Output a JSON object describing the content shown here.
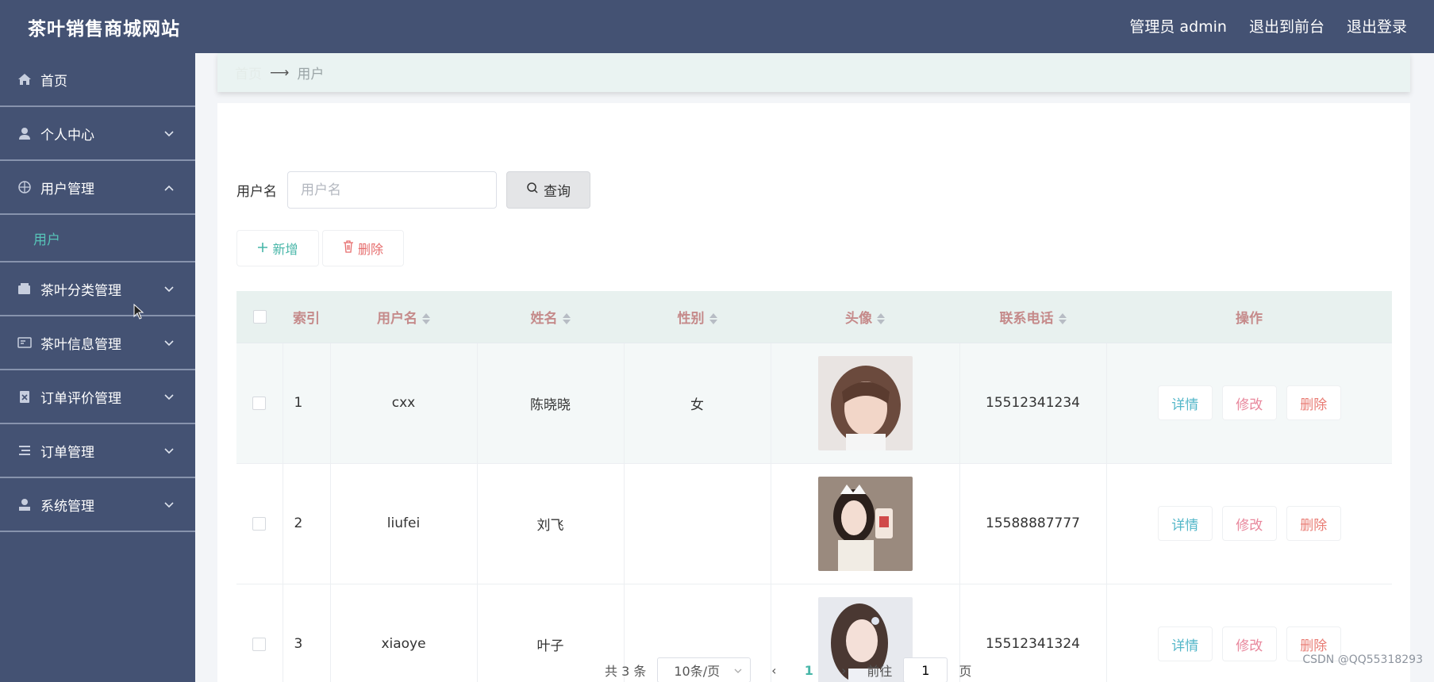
{
  "app": {
    "title": "茶叶销售商城网站",
    "user_label": "管理员 admin",
    "back_to_front": "退出到前台",
    "logout": "退出登录"
  },
  "sidebar": {
    "items": [
      {
        "label": "首页",
        "icon": "home-icon"
      },
      {
        "label": "个人中心",
        "icon": "person-icon"
      },
      {
        "label": "用户管理",
        "icon": "target-icon"
      },
      {
        "label": "茶叶分类管理",
        "icon": "wallet-icon"
      },
      {
        "label": "茶叶信息管理",
        "icon": "card-icon"
      },
      {
        "label": "订单评价管理",
        "icon": "clipboard-icon"
      },
      {
        "label": "订单管理",
        "icon": "list-icon"
      },
      {
        "label": "系统管理",
        "icon": "user-stamp-icon"
      }
    ],
    "active_sub": "用户"
  },
  "breadcrumb": {
    "home": "首页",
    "current": "用户"
  },
  "search": {
    "label": "用户名",
    "placeholder": "用户名",
    "button": "查询"
  },
  "actions": {
    "add": "新增",
    "delete": "删除"
  },
  "table": {
    "headers": {
      "index": "索引",
      "username": "用户名",
      "name": "姓名",
      "gender": "性别",
      "avatar": "头像",
      "phone": "联系电话",
      "ops": "操作"
    },
    "rows": [
      {
        "index": "1",
        "username": "cxx",
        "name": "陈晓晓",
        "gender": "女",
        "phone": "15512341234"
      },
      {
        "index": "2",
        "username": "liufei",
        "name": "刘飞",
        "gender": "",
        "phone": "15588887777"
      },
      {
        "index": "3",
        "username": "xiaoye",
        "name": "叶子",
        "gender": "",
        "phone": "15512341324"
      }
    ],
    "op_labels": {
      "detail": "详情",
      "edit": "修改",
      "delete": "删除"
    }
  },
  "pagination": {
    "total_text": "共 3 条",
    "page_size": "10条/页",
    "current_page": "1",
    "goto_label": "前往",
    "goto_value": "1",
    "page_unit": "页"
  },
  "watermark": "CSDN @QQ55318293",
  "colors": {
    "header_bg": "#445273",
    "accent": "#47b6a8",
    "danger": "#e66d6d"
  }
}
